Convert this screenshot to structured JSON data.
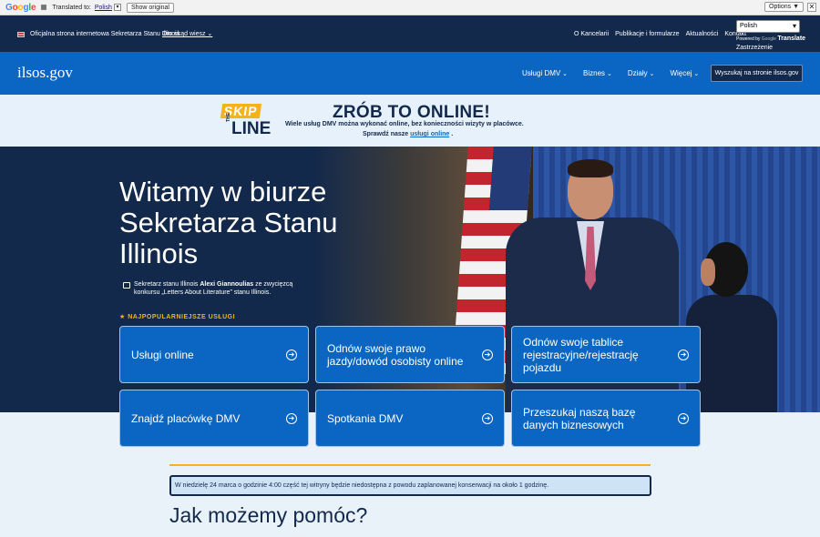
{
  "google_bar": {
    "translated_to": "Translated to:",
    "language": "Polish",
    "show_original": "Show original",
    "options": "Options ▼",
    "close": "✕"
  },
  "official": {
    "text": "Oficjalna strona internetowa Sekretarza Stanu Illinois",
    "link": "Oto skąd wiesz ⌄",
    "nav": [
      "O Kancelarii",
      "Publikacje i formularze",
      "Aktualności",
      "Kontakt"
    ],
    "lang_select": "Polish",
    "powered_by": "Powered by",
    "google": "Google",
    "translate": "Translate",
    "disclaimer": "Zastrzeżenie"
  },
  "nav": {
    "brand": "ilsos.gov",
    "items": [
      "Usługi DMV",
      "Biznes",
      "Działy",
      "Więcej"
    ],
    "search": "Wyszukaj na stronie ilsos.gov"
  },
  "banner": {
    "skip": "SKIP",
    "the": "THE",
    "line": "LINE",
    "title": "ZRÓB TO ONLINE!",
    "sub1": "Wiele usług DMV można wykonać online, bez konieczności wizyty w placówce.",
    "sub2_prefix": "Sprawdź nasze",
    "sub2_link": "usługi online",
    "sub2_suffix": "."
  },
  "hero": {
    "title": "Witamy w biurze Sekretarza Stanu Illinois",
    "caption_pre": "Sekretarz stanu Illinois ",
    "caption_bold": "Alexi Giannoulias",
    "caption_post": " ze zwycięzcą konkursu „Letters About Literature” stanu Illinois.",
    "popular": "★ NAJPOPULARNIEJSZE USŁUGI"
  },
  "services": [
    "Usługi online",
    "Odnów swoje prawo jazdy/dowód osobisty online",
    "Odnów swoje tablice rejestracyjne/rejestrację pojazdu",
    "Znajdź placówkę DMV",
    "Spotkania DMV",
    "Przeszukaj naszą bazę danych biznesowych"
  ],
  "notice": "W niedzielę 24 marca o godzinie 4:00 część tej witryny będzie niedostępna z powodu zaplanowanej konserwacji na około 1 godzinę.",
  "help_title": "Jak możemy pomóc?",
  "colors": {
    "navy": "#13294b",
    "blue": "#0a66c2",
    "gold": "#f3b41b",
    "light": "#eaf2f9"
  }
}
